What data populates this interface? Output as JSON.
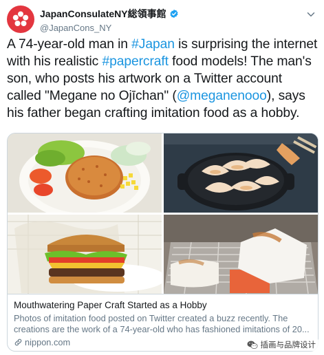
{
  "tweet": {
    "display_name": "JapanConsulateNY総領事館",
    "handle": "@JapanCons_NY",
    "text_parts": [
      {
        "t": "A 74-year-old man in ",
        "link": false
      },
      {
        "t": "#Japan",
        "link": true
      },
      {
        "t": " is surprising the internet with his realistic ",
        "link": false
      },
      {
        "t": "#papercraft",
        "link": true
      },
      {
        "t": " food models! The man's son, who posts his artwork on a Twitter account called \"Megane no Ojīchan\" (",
        "link": false
      },
      {
        "t": "@meganenooo",
        "link": true
      },
      {
        "t": "), says his father began crafting imitation food as a hobby.",
        "link": false
      }
    ]
  },
  "card": {
    "title": "Mouthwatering Paper Craft Started as a Hobby",
    "description": "Photos of imitation food posted on Twitter created a buzz recently. The creations are the work of a 74-year-old who has fashioned imitations of 20...",
    "domain": "nippon.com"
  },
  "watermark": "插画与品牌设计",
  "icons": {
    "avatar": "japan-consulate-flower-logo",
    "verified": "verified-badge-icon",
    "menu": "chevron-down-icon",
    "link": "link-icon",
    "wechat": "wechat-icon"
  },
  "colors": {
    "link": "#1b95e0",
    "verified": "#1da1f2",
    "avatar_bg": "#e3363f",
    "text": "#14171a",
    "secondary": "#657786",
    "border": "#ccd6dd"
  }
}
